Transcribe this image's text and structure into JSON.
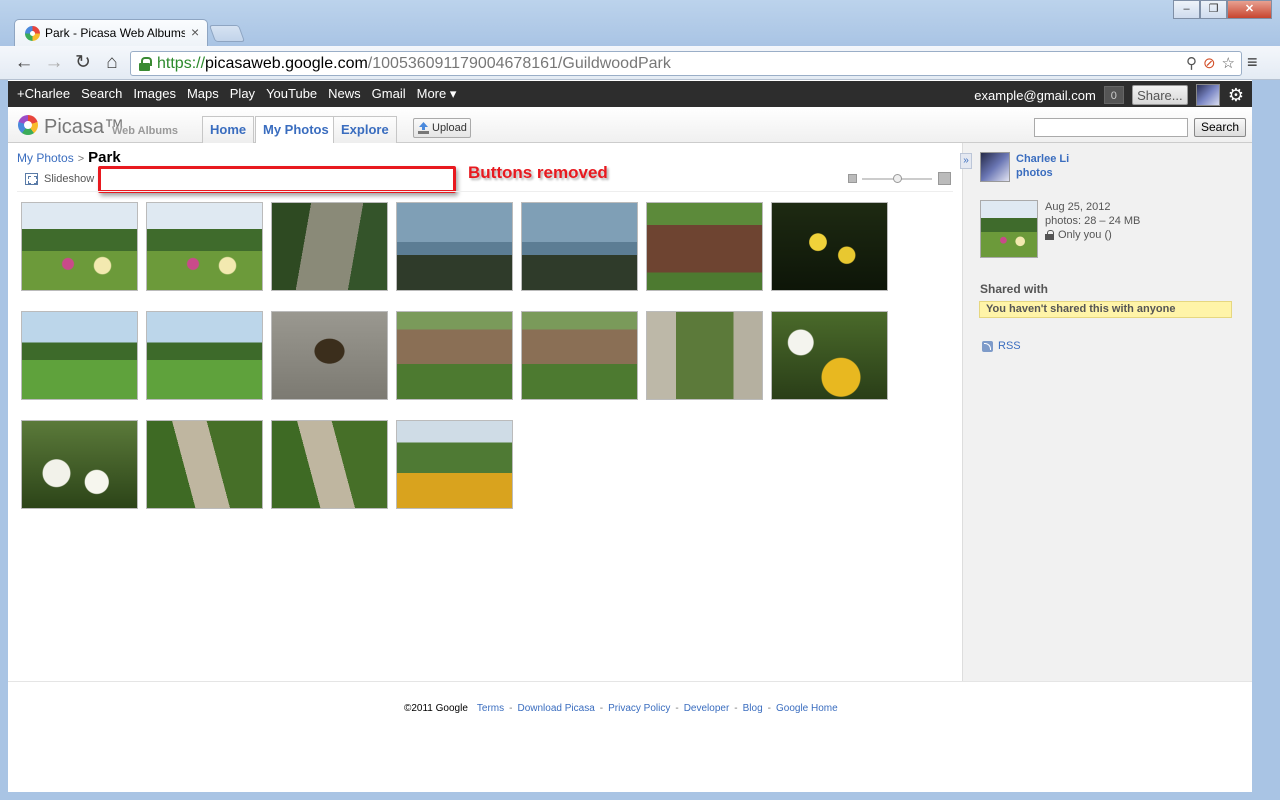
{
  "browser": {
    "tab_title": "Park - Picasa Web Albums",
    "url_scheme": "https://",
    "url_host": "picasaweb.google.com",
    "url_path": "/100536091179004678161/GuildwoodPark"
  },
  "gbar": {
    "links": [
      "+Charlee",
      "Search",
      "Images",
      "Maps",
      "Play",
      "YouTube",
      "News",
      "Gmail",
      "More ▾"
    ],
    "email": "example@gmail.com",
    "count": "0",
    "share_label": "Share..."
  },
  "picasa": {
    "wordmark": "Picasa™",
    "subtitle": "Web Albums",
    "tabs": [
      "Home",
      "My Photos",
      "Explore"
    ],
    "active_tab": "My Photos",
    "upload_label": "Upload",
    "search_placeholder": "",
    "search_button": "Search"
  },
  "album": {
    "breadcrumb_parent": "My Photos",
    "breadcrumb_sep": ">",
    "title": "Park",
    "slideshow_label": "Slideshow",
    "annotation": "Buttons removed"
  },
  "photos": [
    {
      "scene": "garden-gazebo"
    },
    {
      "scene": "garden-gazebo"
    },
    {
      "scene": "forest-path"
    },
    {
      "scene": "lake-view"
    },
    {
      "scene": "lake-view"
    },
    {
      "scene": "graffiti-plaque"
    },
    {
      "scene": "yellow-flowers-dark"
    },
    {
      "scene": "columns-lawn"
    },
    {
      "scene": "columns-lawn"
    },
    {
      "scene": "stone-plaque"
    },
    {
      "scene": "log-cabin"
    },
    {
      "scene": "log-cabin"
    },
    {
      "scene": "stone-arch"
    },
    {
      "scene": "white-yellow-flowers"
    },
    {
      "scene": "white-flowers"
    },
    {
      "scene": "garden-path"
    },
    {
      "scene": "garden-path"
    },
    {
      "scene": "columns-flowerbed"
    }
  ],
  "sidebar": {
    "owner_name": "Charlee Li",
    "owner_photos": "photos",
    "date": "Aug 25, 2012",
    "photo_count": "photos: 28 – 24 MB",
    "visibility": "Only you ()",
    "shared_heading": "Shared with",
    "shared_note": "You haven't shared this with anyone",
    "rss_label": "RSS"
  },
  "footer": {
    "copyright": "©2011 Google",
    "links": [
      "Terms",
      "Download Picasa",
      "Privacy Policy",
      "Developer",
      "Blog",
      "Google Home"
    ],
    "separator": "-"
  }
}
